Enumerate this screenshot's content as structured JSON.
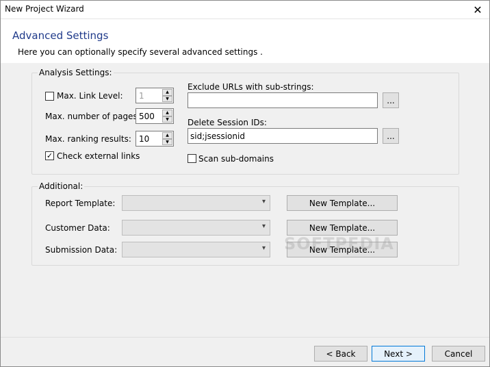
{
  "window": {
    "title": "New Project Wizard"
  },
  "header": {
    "title": "Advanced Settings",
    "subtitle": "Here you can optionally specify several advanced settings ."
  },
  "analysis": {
    "legend": "Analysis Settings:",
    "max_link_level": {
      "label": "Max. Link Level:",
      "value": "1",
      "checked": false
    },
    "max_pages": {
      "label": "Max. number of pages:",
      "value": "500"
    },
    "max_ranking": {
      "label": "Max. ranking results:",
      "value": "10"
    },
    "check_external": {
      "label": "Check external links",
      "checked": true
    },
    "exclude_urls": {
      "label": "Exclude URLs with sub-strings:",
      "value": ""
    },
    "delete_session": {
      "label": "Delete Session IDs:",
      "value": "sid;jsessionid"
    },
    "scan_subdomains": {
      "label": "Scan sub-domains",
      "checked": false
    },
    "browse_label": "..."
  },
  "additional": {
    "legend": "Additional:",
    "report_template": {
      "label": "Report Template:",
      "value": ""
    },
    "customer_data": {
      "label": "Customer Data:",
      "value": ""
    },
    "submission_data": {
      "label": "Submission Data:",
      "value": ""
    },
    "new_template_label": "New Template..."
  },
  "footer": {
    "back_label": "< Back",
    "next_label": "Next >",
    "cancel_label": "Cancel"
  },
  "watermark": "SOFTPEDIA"
}
